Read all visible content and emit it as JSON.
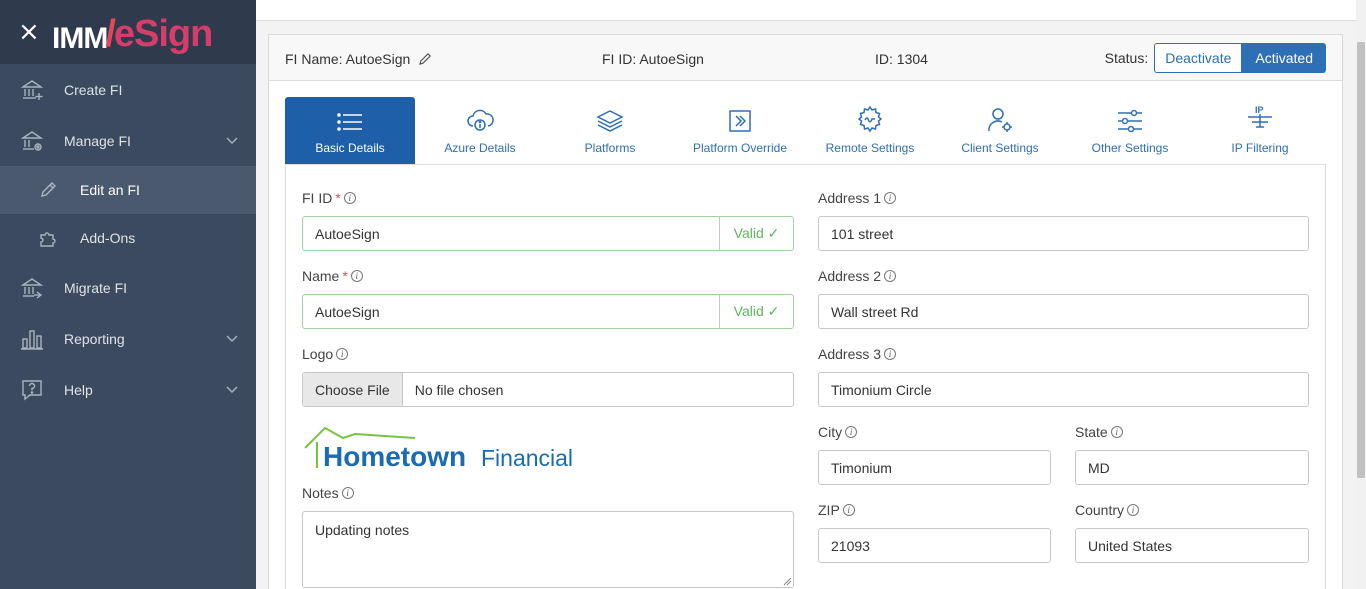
{
  "app": {
    "logo_left": "IMM",
    "logo_slash": "/",
    "logo_right": "eSign"
  },
  "sidebar": {
    "items": [
      {
        "label": "Create FI",
        "icon": "bank-add-icon"
      },
      {
        "label": "Manage FI",
        "icon": "bank-gear-icon"
      },
      {
        "label": "Edit an FI",
        "icon": "pencil-icon"
      },
      {
        "label": "Add-Ons",
        "icon": "puzzle-icon"
      },
      {
        "label": "Migrate FI",
        "icon": "bank-arrow-icon"
      },
      {
        "label": "Reporting",
        "icon": "bar-chart-icon"
      },
      {
        "label": "Help",
        "icon": "help-bubble-icon"
      }
    ]
  },
  "header": {
    "fi_name": "FI Name: AutoeSign",
    "fi_id": "FI ID: AutoeSign",
    "id": "ID: 1304",
    "status_label": "Status:",
    "deactivate_label": "Deactivate",
    "activated_label": "Activated"
  },
  "tabs": [
    {
      "label": "Basic Details",
      "icon": "list-icon",
      "active": true
    },
    {
      "label": "Azure Details",
      "icon": "cloud-info-icon"
    },
    {
      "label": "Platforms",
      "icon": "layers-icon"
    },
    {
      "label": "Platform Override",
      "icon": "arrow-box-icon"
    },
    {
      "label": "Remote Settings",
      "icon": "gear-signature-icon"
    },
    {
      "label": "Client Settings",
      "icon": "user-gear-icon"
    },
    {
      "label": "Other Settings",
      "icon": "sliders-icon"
    },
    {
      "label": "IP Filtering",
      "icon": "ip-filter-icon"
    }
  ],
  "form": {
    "fi_id": {
      "label": "FI ID",
      "required": "*",
      "value": "AutoeSign",
      "valid": "Valid ✓"
    },
    "name": {
      "label": "Name",
      "required": "*",
      "value": "AutoeSign",
      "valid": "Valid ✓"
    },
    "logo": {
      "label": "Logo",
      "choose": "Choose File",
      "file": "No file chosen"
    },
    "brand": {
      "word1": "Hometown",
      "word2": "Financial"
    },
    "notes": {
      "label": "Notes",
      "value": "Updating notes"
    },
    "address1": {
      "label": "Address 1",
      "value": "101 street"
    },
    "address2": {
      "label": "Address 2",
      "value": "Wall street Rd"
    },
    "address3": {
      "label": "Address 3",
      "value": "Timonium Circle"
    },
    "city": {
      "label": "City",
      "value": "Timonium"
    },
    "state": {
      "label": "State",
      "value": "MD"
    },
    "zip": {
      "label": "ZIP",
      "value": "21093"
    },
    "country": {
      "label": "Country",
      "value": "United States"
    },
    "info_glyph": "i"
  },
  "colors": {
    "sidebar": "#3b4a5e",
    "accent": "#2e6fb5",
    "active_tab": "#1d5fa8",
    "valid": "#5cb85c",
    "brand_blue": "#1a6bb0",
    "brand_green": "#7cc242"
  }
}
